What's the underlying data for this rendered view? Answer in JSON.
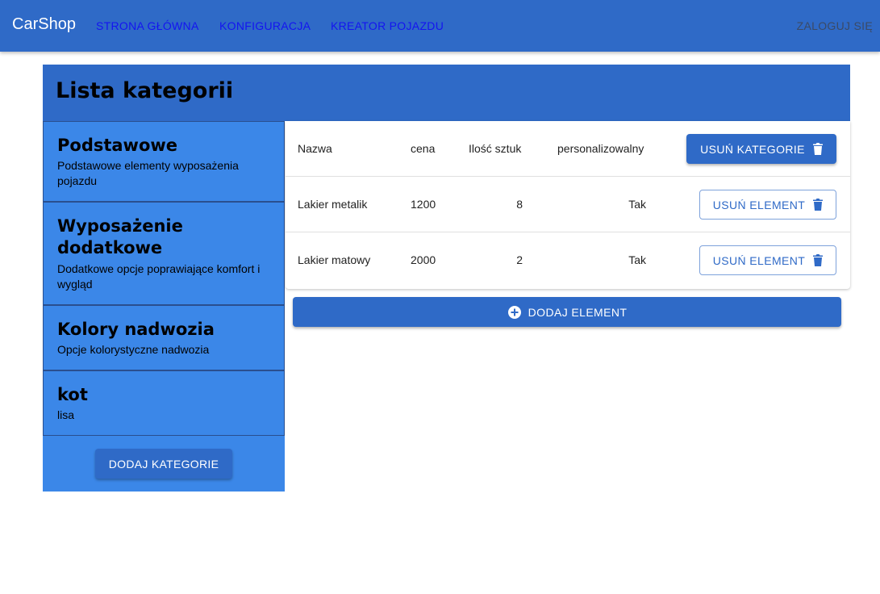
{
  "appbar": {
    "brand": "CarShop",
    "nav": [
      "STRONA GŁÓWNA",
      "KONFIGURACJA",
      "KREATOR POJAZDU"
    ],
    "login": "ZALOGUJ SIĘ"
  },
  "panel": {
    "title": "Lista kategorii",
    "add_category_label": "DODAJ KATEGORIE",
    "categories": [
      {
        "name": "Podstawowe",
        "description": "Podstawowe elementy wyposażenia pojazdu"
      },
      {
        "name": "Wyposażenie dodatkowe",
        "description": "Dodatkowe opcje poprawiające komfort i wygląd"
      },
      {
        "name": "Kolory nadwozia",
        "description": "Opcje kolorystyczne nadwozia"
      },
      {
        "name": "kot",
        "description": "lisa"
      }
    ]
  },
  "table": {
    "headers": {
      "name": "Nazwa",
      "price": "cena",
      "qty": "Ilość sztuk",
      "custom": "personalizowalny"
    },
    "delete_category_label": "USUŃ KATEGORIE",
    "delete_element_label": "USUŃ ELEMENT",
    "rows": [
      {
        "name": "Lakier metalik",
        "price": "1200",
        "qty": "8",
        "custom": "Tak"
      },
      {
        "name": "Lakier matowy",
        "price": "2000",
        "qty": "2",
        "custom": "Tak"
      }
    ],
    "add_element_label": "DODAJ ELEMENT"
  },
  "icons": {
    "delete": "trash-icon",
    "add": "plus-circle-icon"
  },
  "colors": {
    "primary": "#2f6ac7",
    "sidebar": "#3b87e8",
    "nav_link": "#1414f0"
  }
}
